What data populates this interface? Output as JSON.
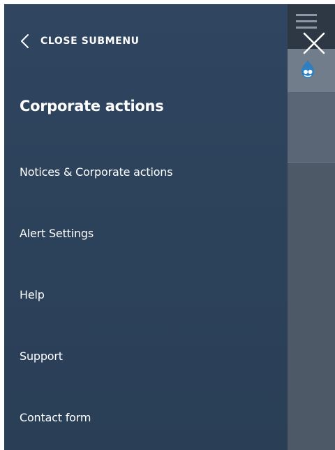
{
  "drawer": {
    "back_label": "CLOSE SUBMENU",
    "title": "Corporate actions",
    "items": [
      {
        "label": "Notices & Corporate actions"
      },
      {
        "label": "Alert Settings"
      },
      {
        "label": "Help"
      },
      {
        "label": "Support"
      },
      {
        "label": "Contact form"
      }
    ]
  },
  "icons": {
    "back": "chevron-left-icon",
    "close": "close-icon",
    "menu": "hamburger-menu-icon",
    "logo": "drupal-logo-icon"
  },
  "colors": {
    "drawer_bg": "#2d435c",
    "overlay_bg": "#4f5b69",
    "text": "#ffffff"
  }
}
